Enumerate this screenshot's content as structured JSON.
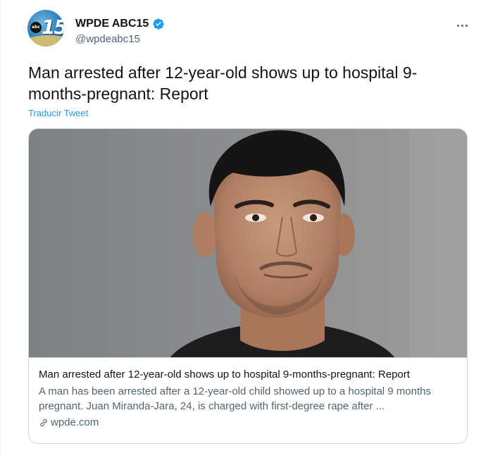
{
  "account": {
    "display_name": "WPDE ABC15",
    "handle": "@wpdeabc15",
    "avatar_badge": "abc",
    "avatar_number": "15",
    "verified": true
  },
  "tweet": {
    "text": "Man arrested after 12-year-old shows up to hospital 9-months-pregnant: Report",
    "translate_label": "Traducir Tweet"
  },
  "card": {
    "title": "Man arrested after 12-year-old shows up to hospital 9-months-pregnant: Report",
    "description": "A man has been arrested after a 12-year-old child showed up to a hospital 9 months pregnant. Juan Miranda-Jara, 24, is charged with first-degree rape after ...",
    "domain": "wpde.com"
  },
  "colors": {
    "accent": "#1d9bf0",
    "text_primary": "#0f1419",
    "text_secondary": "#536471",
    "border": "#cfd9de",
    "photo_background": "#87898a"
  },
  "icons": {
    "verified": "verified-badge-icon",
    "more": "more-options-icon",
    "link": "link-icon"
  }
}
